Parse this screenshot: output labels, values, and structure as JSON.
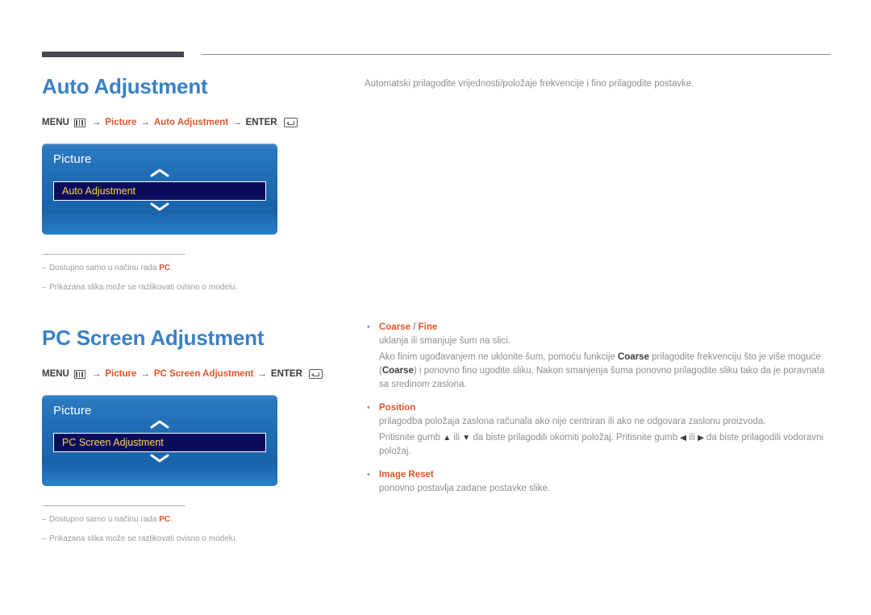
{
  "header": {
    "rule_thick": "decorative-dark-bar",
    "rule_thin": "decorative-thin-line"
  },
  "sections": [
    {
      "id": "auto-adjustment",
      "title": "Auto Adjustment",
      "menu_path": {
        "menu_label": "MENU",
        "menu_icon": "menu-icon",
        "arrow": "→",
        "step1": "Picture",
        "step2": "Auto Adjustment",
        "enter_label": "ENTER",
        "enter_icon": "enter-icon"
      },
      "osd": {
        "title": "Picture",
        "up_icon": "chevron-up-icon",
        "down_icon": "chevron-down-icon",
        "selected_item": "Auto Adjustment"
      },
      "notes": [
        {
          "text_before": "Dostupno samo u načinu rada ",
          "bold": "PC",
          "text_after": "."
        },
        {
          "text_before": "Prikazana slika može se razlikovati ovisno o modelu.",
          "bold": "",
          "text_after": ""
        }
      ]
    },
    {
      "id": "pc-screen-adjustment",
      "title": "PC Screen Adjustment",
      "menu_path": {
        "menu_label": "MENU",
        "menu_icon": "menu-icon",
        "arrow": "→",
        "step1": "Picture",
        "step2": "PC Screen Adjustment",
        "enter_label": "ENTER",
        "enter_icon": "enter-icon"
      },
      "osd": {
        "title": "Picture",
        "up_icon": "chevron-up-icon",
        "down_icon": "chevron-down-icon",
        "selected_item": "PC Screen Adjustment"
      },
      "notes": [
        {
          "text_before": "Dostupno samo u načinu rada ",
          "bold": "PC",
          "text_after": "."
        },
        {
          "text_before": "Prikazana slika može se razlikovati ovisno o modelu.",
          "bold": "",
          "text_after": ""
        }
      ]
    }
  ],
  "right": {
    "intro": "Automatski prilagodite vrijednosti/položaje frekvencije i fino prilagodite postavke.",
    "bullets": [
      {
        "term_main": "Coarse",
        "term_sep": " / ",
        "term_alt": "Fine",
        "lines": [
          "uklanja ili smanjuje šum na slici.",
          "Ako finim ugođavanjem ne uklonite šum, pomoću funkcije Coarse prilagodite frekvenciju što je više moguće (Coarse) i ponovno fino ugodite sliku. Nakon smanjenja šuma ponovno prilagodite sliku tako da je poravnata sa sredinom zaslona."
        ],
        "line2_parts": {
          "a": "Ako finim ugođavanjem ne uklonite šum, pomoću funkcije ",
          "b1": "Coarse",
          "c": " prilagodite frekvenciju što je više moguće (",
          "b2": "Coarse",
          "d": ") i ponovno fino ugodite sliku. Nakon smanjenja šuma ponovno prilagodite sliku tako da je poravnata sa sredinom zaslona."
        }
      },
      {
        "term_main": "Position",
        "term_sep": "",
        "term_alt": "",
        "lines": [
          "prilagodba položaja zaslona računala ako nije centriran ili ako ne odgovara zaslonu proizvoda."
        ],
        "line2_parts": {
          "a": "Pritisnite gumb ",
          "g1": "▲",
          "b": " ili ",
          "g2": "▼",
          "c": " da biste prilagodili okomiti položaj. Pritisnite gumb ",
          "g3": "◀",
          "d": " ili ",
          "g4": "▶",
          "e": " da biste prilagodili vodoravni položaj."
        }
      },
      {
        "term_main": "Image Reset",
        "term_sep": "",
        "term_alt": "",
        "lines": [
          "ponovno postavlja zadane postavke slike."
        ]
      }
    ],
    "bullet_dot": "•"
  },
  "colors": {
    "heading_blue": "#3a81c4",
    "accent_orange": "#e0562a",
    "body_gray": "#8e8e8e",
    "osd_blue": "#1f6cb4",
    "osd_selected_navy": "#0c0c5e",
    "osd_selected_gold": "#ffd24a",
    "rule_dark": "#474754"
  }
}
